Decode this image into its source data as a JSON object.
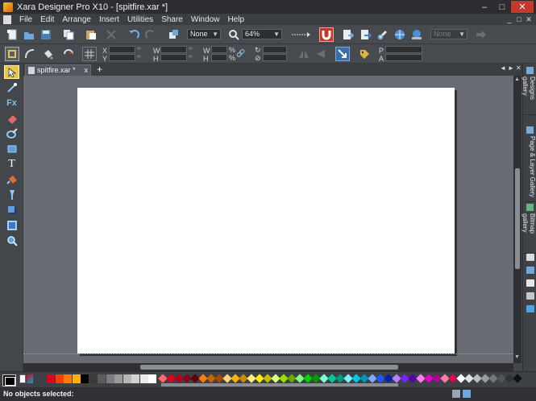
{
  "window": {
    "title": "Xara Designer Pro X10 - [spitfire.xar *]",
    "buttons": [
      "–",
      "□",
      "✕"
    ]
  },
  "menu": [
    "File",
    "Edit",
    "Arrange",
    "Insert",
    "Utilities",
    "Share",
    "Window",
    "Help"
  ],
  "mdi_controls": [
    "_",
    "□",
    "✕"
  ],
  "toolbar": {
    "feather_value": "None",
    "zoom_value": "64%",
    "style_value": "None"
  },
  "infobar": {
    "labels": {
      "x": "X",
      "y": "Y",
      "w": "W",
      "h": "H",
      "w2": "W",
      "h2": "H",
      "pct1": "%",
      "pct2": "%",
      "p": "P",
      "a": "A"
    },
    "values": {
      "x": "",
      "y": "",
      "w": "",
      "h": "",
      "w_pct": "",
      "h_pct": "",
      "rotate": "",
      "skew": ""
    }
  },
  "tabs": [
    {
      "label": "spitfire.xar *",
      "close": "x"
    }
  ],
  "tab_controls": [
    "◄",
    "►",
    "✕"
  ],
  "galleries": [
    "Designs gallery",
    "Page & Layer Gallery",
    "Bitmap gallery"
  ],
  "palette": {
    "solid_colors": [
      "#e3001b",
      "#ff3b00",
      "#ff7a00",
      "#ffb000",
      "#000000",
      "#3a3a3a",
      "#5c5c5c",
      "#7d7d7d",
      "#9a9a9a",
      "#b6b6b6",
      "#d2d2d2",
      "#ebebeb",
      "#ffffff"
    ],
    "diamond_colors": [
      "#ff6b6b",
      "#e3001b",
      "#b5001a",
      "#8a0015",
      "#5c0010",
      "#ff7a00",
      "#cc6200",
      "#a04d00",
      "#ffd27f",
      "#ffb000",
      "#c98a00",
      "#fff27f",
      "#ffeb00",
      "#c9b900",
      "#d8ff7f",
      "#9be000",
      "#6aa800",
      "#7fff7f",
      "#00d400",
      "#009900",
      "#7fffd4",
      "#00c9a0",
      "#00997a",
      "#7fefff",
      "#00c8e8",
      "#0098b0",
      "#7fa8ff",
      "#2255ff",
      "#0022b0",
      "#b87fff",
      "#7a22ff",
      "#5500b0",
      "#ff7fe8",
      "#e800c8",
      "#b0009a",
      "#ff7fa8",
      "#e80055",
      "#ffffff",
      "#e0e0e0",
      "#bdbdbd",
      "#9a9a9a",
      "#777777",
      "#545454",
      "#333333",
      "#111111"
    ]
  },
  "status": {
    "text": "No objects selected:"
  }
}
